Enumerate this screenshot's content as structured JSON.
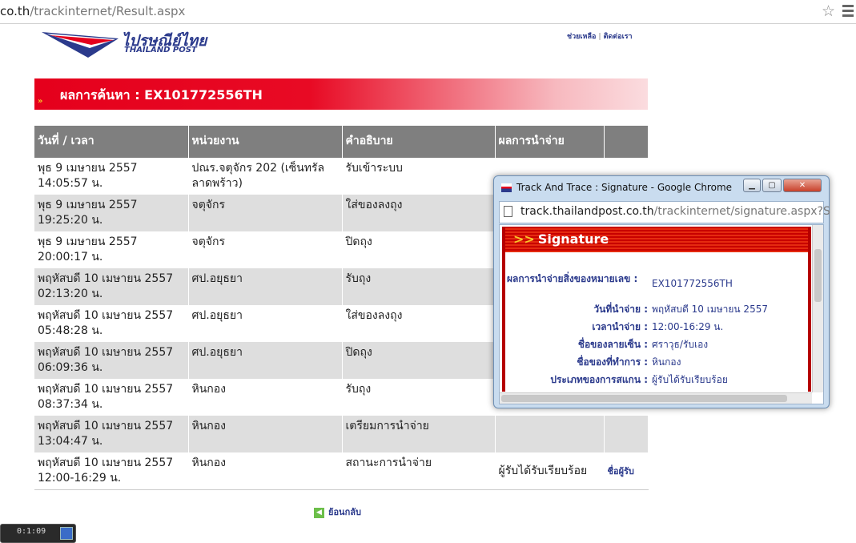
{
  "browser": {
    "url_host": "co.th",
    "url_path": "/trackinternet/Result.aspx"
  },
  "header": {
    "logo_thai": "ไปรษณีย์ไทย",
    "logo_english": "THAILAND POST",
    "links": [
      "ช่วยเหลือ",
      "ติดต่อเรา"
    ]
  },
  "banner": {
    "arrows": "»",
    "title": "ผลการค้นหา : EX101772556TH"
  },
  "table": {
    "headers": [
      "วันที่ / เวลา",
      "หน่วยงาน",
      "คำอธิบาย",
      "ผลการนำจ่าย",
      ""
    ],
    "rows": [
      {
        "date": "พุธ 9 เมษายน 2557",
        "time": "14:05:57 น.",
        "office": "ปณร.จตุจักร 202 (เซ็นทรัลลาดพร้าว)",
        "desc": "รับเข้าระบบ",
        "result": "",
        "sig": ""
      },
      {
        "date": "พุธ 9 เมษายน 2557",
        "time": "19:25:20 น.",
        "office": "จตุจักร",
        "desc": "ใส่ของลงถุง",
        "result": "",
        "sig": ""
      },
      {
        "date": "พุธ 9 เมษายน 2557",
        "time": "20:00:17 น.",
        "office": "จตุจักร",
        "desc": "ปิดถุง",
        "result": "",
        "sig": ""
      },
      {
        "date": "พฤหัสบดี 10 เมษายน 2557",
        "time": "02:13:20 น.",
        "office": "ศป.อยุธยา",
        "desc": "รับถุง",
        "result": "",
        "sig": ""
      },
      {
        "date": "พฤหัสบดี 10 เมษายน 2557",
        "time": "05:48:28 น.",
        "office": "ศป.อยุธยา",
        "desc": "ใส่ของลงถุง",
        "result": "",
        "sig": ""
      },
      {
        "date": "พฤหัสบดี 10 เมษายน 2557",
        "time": "06:09:36 น.",
        "office": "ศป.อยุธยา",
        "desc": "ปิดถุง",
        "result": "",
        "sig": ""
      },
      {
        "date": "พฤหัสบดี 10 เมษายน 2557",
        "time": "08:37:34 น.",
        "office": "หินกอง",
        "desc": "รับถุง",
        "result": "",
        "sig": ""
      },
      {
        "date": "พฤหัสบดี 10 เมษายน 2557",
        "time": "13:04:47 น.",
        "office": "หินกอง",
        "desc": "เตรียมการนำจ่าย",
        "result": "",
        "sig": ""
      },
      {
        "date": "พฤหัสบดี 10 เมษายน 2557",
        "time": "12:00-16:29 น.",
        "office": "หินกอง",
        "desc": "สถานะการนำจ่าย",
        "result": "ผู้รับได้รับเรียบร้อย",
        "sig": "ชื่อผู้รับ"
      }
    ]
  },
  "back_link": "ย้อนกลับ",
  "taskbar": {
    "time": "0:1:09"
  },
  "popup": {
    "window_title": "Track And Trace : Signature - Google Chrome",
    "url_host": "track.thailandpost.co.th",
    "url_path": "/trackinternet/signature.aspx?S",
    "heading_arrows": ">>",
    "heading": "Signature",
    "fields": [
      {
        "label": "ผลการนำจ่ายสิ่งของหมายเลข :",
        "value": "EX101772556TH"
      },
      {
        "label": "วันที่นำจ่าย :",
        "value": "พฤหัสบดี 10 เมษายน 2557"
      },
      {
        "label": "เวลานำจ่าย :",
        "value": "12:00-16:29 น."
      },
      {
        "label": "ชื่อของลายเซ็น :",
        "value": "ศราวุธ/รับเอง"
      },
      {
        "label": "ชื่อของที่ทำการ :",
        "value": "หินกอง"
      },
      {
        "label": "ประเภทของการสแกน :",
        "value": "ผู้รับได้รับเรียบร้อย"
      }
    ]
  },
  "colors": {
    "brand_blue": "#2b3a8c",
    "brand_red": "#e5001c",
    "header_gray": "#7f7f7f",
    "row_gray": "#dedede"
  }
}
